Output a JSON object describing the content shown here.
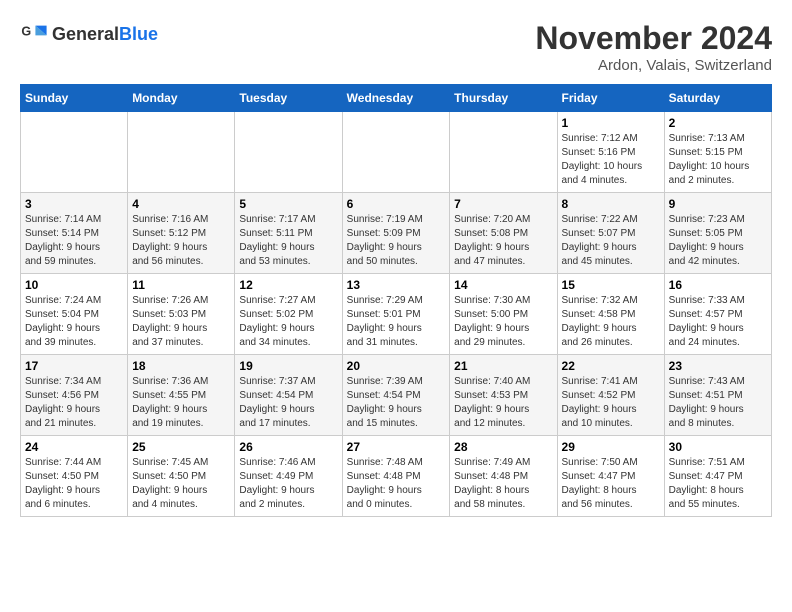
{
  "logo": {
    "text_general": "General",
    "text_blue": "Blue"
  },
  "title": {
    "month_year": "November 2024",
    "location": "Ardon, Valais, Switzerland"
  },
  "weekdays": [
    "Sunday",
    "Monday",
    "Tuesday",
    "Wednesday",
    "Thursday",
    "Friday",
    "Saturday"
  ],
  "weeks": [
    [
      {
        "day": "",
        "info": ""
      },
      {
        "day": "",
        "info": ""
      },
      {
        "day": "",
        "info": ""
      },
      {
        "day": "",
        "info": ""
      },
      {
        "day": "",
        "info": ""
      },
      {
        "day": "1",
        "info": "Sunrise: 7:12 AM\nSunset: 5:16 PM\nDaylight: 10 hours\nand 4 minutes."
      },
      {
        "day": "2",
        "info": "Sunrise: 7:13 AM\nSunset: 5:15 PM\nDaylight: 10 hours\nand 2 minutes."
      }
    ],
    [
      {
        "day": "3",
        "info": "Sunrise: 7:14 AM\nSunset: 5:14 PM\nDaylight: 9 hours\nand 59 minutes."
      },
      {
        "day": "4",
        "info": "Sunrise: 7:16 AM\nSunset: 5:12 PM\nDaylight: 9 hours\nand 56 minutes."
      },
      {
        "day": "5",
        "info": "Sunrise: 7:17 AM\nSunset: 5:11 PM\nDaylight: 9 hours\nand 53 minutes."
      },
      {
        "day": "6",
        "info": "Sunrise: 7:19 AM\nSunset: 5:09 PM\nDaylight: 9 hours\nand 50 minutes."
      },
      {
        "day": "7",
        "info": "Sunrise: 7:20 AM\nSunset: 5:08 PM\nDaylight: 9 hours\nand 47 minutes."
      },
      {
        "day": "8",
        "info": "Sunrise: 7:22 AM\nSunset: 5:07 PM\nDaylight: 9 hours\nand 45 minutes."
      },
      {
        "day": "9",
        "info": "Sunrise: 7:23 AM\nSunset: 5:05 PM\nDaylight: 9 hours\nand 42 minutes."
      }
    ],
    [
      {
        "day": "10",
        "info": "Sunrise: 7:24 AM\nSunset: 5:04 PM\nDaylight: 9 hours\nand 39 minutes."
      },
      {
        "day": "11",
        "info": "Sunrise: 7:26 AM\nSunset: 5:03 PM\nDaylight: 9 hours\nand 37 minutes."
      },
      {
        "day": "12",
        "info": "Sunrise: 7:27 AM\nSunset: 5:02 PM\nDaylight: 9 hours\nand 34 minutes."
      },
      {
        "day": "13",
        "info": "Sunrise: 7:29 AM\nSunset: 5:01 PM\nDaylight: 9 hours\nand 31 minutes."
      },
      {
        "day": "14",
        "info": "Sunrise: 7:30 AM\nSunset: 5:00 PM\nDaylight: 9 hours\nand 29 minutes."
      },
      {
        "day": "15",
        "info": "Sunrise: 7:32 AM\nSunset: 4:58 PM\nDaylight: 9 hours\nand 26 minutes."
      },
      {
        "day": "16",
        "info": "Sunrise: 7:33 AM\nSunset: 4:57 PM\nDaylight: 9 hours\nand 24 minutes."
      }
    ],
    [
      {
        "day": "17",
        "info": "Sunrise: 7:34 AM\nSunset: 4:56 PM\nDaylight: 9 hours\nand 21 minutes."
      },
      {
        "day": "18",
        "info": "Sunrise: 7:36 AM\nSunset: 4:55 PM\nDaylight: 9 hours\nand 19 minutes."
      },
      {
        "day": "19",
        "info": "Sunrise: 7:37 AM\nSunset: 4:54 PM\nDaylight: 9 hours\nand 17 minutes."
      },
      {
        "day": "20",
        "info": "Sunrise: 7:39 AM\nSunset: 4:54 PM\nDaylight: 9 hours\nand 15 minutes."
      },
      {
        "day": "21",
        "info": "Sunrise: 7:40 AM\nSunset: 4:53 PM\nDaylight: 9 hours\nand 12 minutes."
      },
      {
        "day": "22",
        "info": "Sunrise: 7:41 AM\nSunset: 4:52 PM\nDaylight: 9 hours\nand 10 minutes."
      },
      {
        "day": "23",
        "info": "Sunrise: 7:43 AM\nSunset: 4:51 PM\nDaylight: 9 hours\nand 8 minutes."
      }
    ],
    [
      {
        "day": "24",
        "info": "Sunrise: 7:44 AM\nSunset: 4:50 PM\nDaylight: 9 hours\nand 6 minutes."
      },
      {
        "day": "25",
        "info": "Sunrise: 7:45 AM\nSunset: 4:50 PM\nDaylight: 9 hours\nand 4 minutes."
      },
      {
        "day": "26",
        "info": "Sunrise: 7:46 AM\nSunset: 4:49 PM\nDaylight: 9 hours\nand 2 minutes."
      },
      {
        "day": "27",
        "info": "Sunrise: 7:48 AM\nSunset: 4:48 PM\nDaylight: 9 hours\nand 0 minutes."
      },
      {
        "day": "28",
        "info": "Sunrise: 7:49 AM\nSunset: 4:48 PM\nDaylight: 8 hours\nand 58 minutes."
      },
      {
        "day": "29",
        "info": "Sunrise: 7:50 AM\nSunset: 4:47 PM\nDaylight: 8 hours\nand 56 minutes."
      },
      {
        "day": "30",
        "info": "Sunrise: 7:51 AM\nSunset: 4:47 PM\nDaylight: 8 hours\nand 55 minutes."
      }
    ]
  ]
}
